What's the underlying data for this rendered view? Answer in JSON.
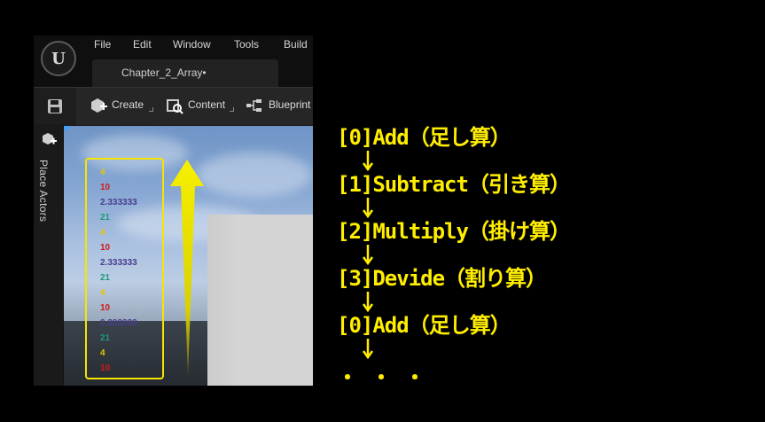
{
  "menu": {
    "items": [
      "File",
      "Edit",
      "Window",
      "Tools",
      "Build"
    ],
    "tab_title": "Chapter_2_Array•"
  },
  "toolbar": {
    "create_label": "Create",
    "content_label": "Content",
    "blueprint_label": "Blueprint"
  },
  "side_panel": {
    "place_actors_label": "Place Actors"
  },
  "log_lines": [
    {
      "text": "4",
      "color": "#e6c400"
    },
    {
      "text": "10",
      "color": "#d11a1a"
    },
    {
      "text": "2.333333",
      "color": "#4a3c8f"
    },
    {
      "text": "21",
      "color": "#1f9a7a"
    },
    {
      "text": "4",
      "color": "#e6c400"
    },
    {
      "text": "10",
      "color": "#d11a1a"
    },
    {
      "text": "2.333333",
      "color": "#4a3c8f"
    },
    {
      "text": "21",
      "color": "#1f9a7a"
    },
    {
      "text": "4",
      "color": "#e6c400"
    },
    {
      "text": "10",
      "color": "#d11a1a"
    },
    {
      "text": "2.333333",
      "color": "#4a3c8f"
    },
    {
      "text": "21",
      "color": "#1f9a7a"
    },
    {
      "text": "4",
      "color": "#e6c400"
    },
    {
      "text": "10",
      "color": "#d11a1a"
    }
  ],
  "annotation": {
    "steps": [
      "[0]Add（足し算）",
      "[1]Subtract（引き算）",
      "[2]Multiply（掛け算）",
      "[3]Devide（割り算）",
      "[0]Add（足し算）"
    ],
    "ellipsis": "・・・"
  },
  "colors": {
    "highlight": "#ffee00",
    "log_box_border": "#f5e500"
  }
}
